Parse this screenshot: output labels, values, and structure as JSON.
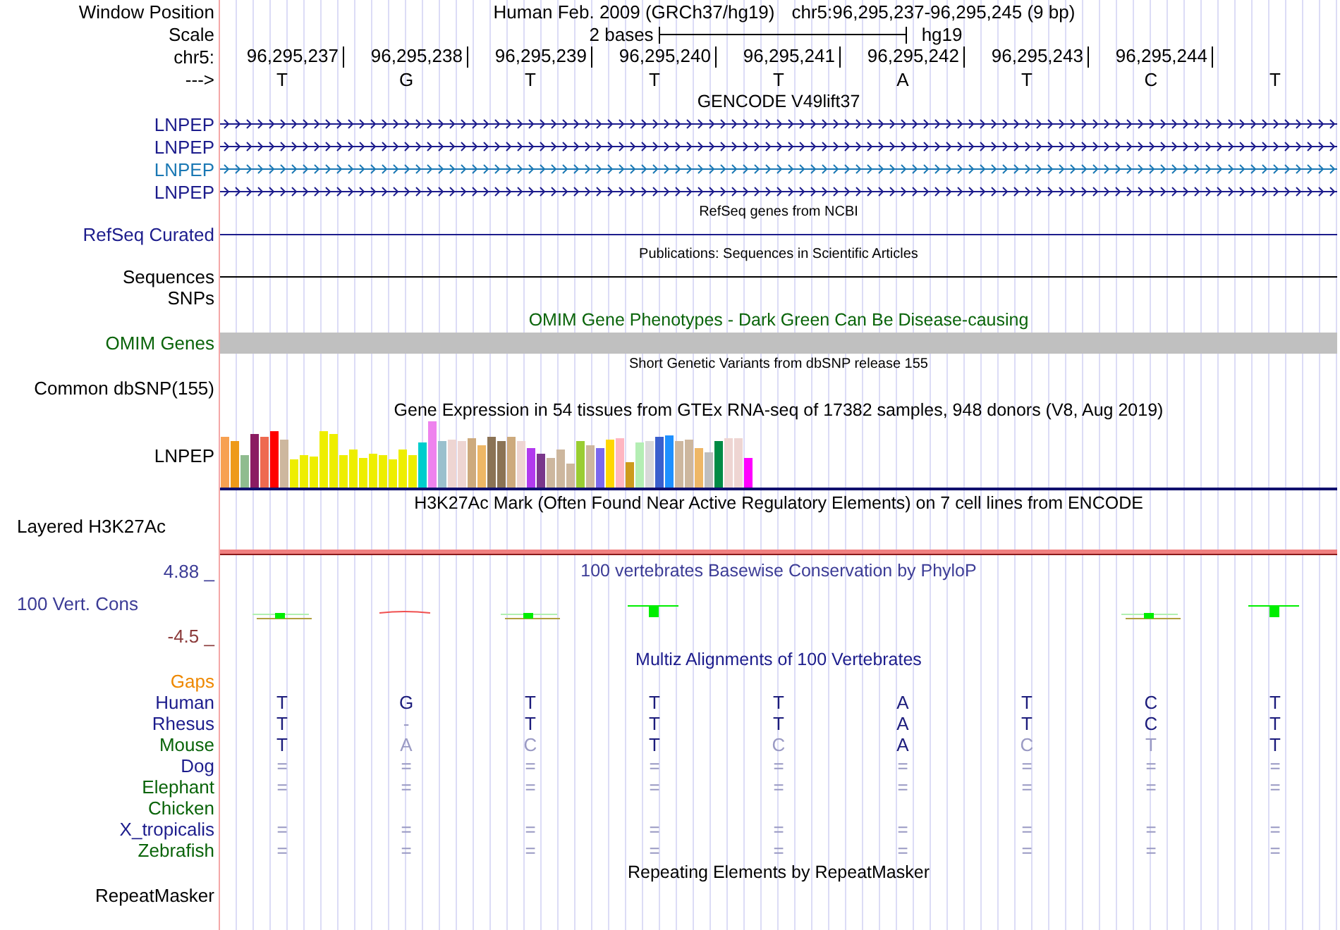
{
  "header": {
    "label": "Window Position",
    "title": "Human Feb. 2009 (GRCh37/hg19)",
    "position": "chr5:96,295,237-96,295,245 (9 bp)"
  },
  "scale": {
    "label": "Scale",
    "length": "2 bases",
    "assembly": "hg19"
  },
  "ruler": {
    "label": "chr5:",
    "ticks": [
      "96,295,237",
      "96,295,238",
      "96,295,239",
      "96,295,240",
      "96,295,241",
      "96,295,242",
      "96,295,243",
      "96,295,244"
    ],
    "strand": "--->",
    "bases": [
      "T",
      "G",
      "T",
      "T",
      "T",
      "A",
      "T",
      "C",
      "T"
    ]
  },
  "tracks": [
    {
      "kind": "gene",
      "title": "GENCODE V49lift37",
      "transcripts": [
        {
          "name": "LNPEP",
          "color": "#1c1c8c"
        },
        {
          "name": "LNPEP",
          "color": "#1c1c8c"
        },
        {
          "name": "LNPEP",
          "color": "#1a78b4"
        },
        {
          "name": "LNPEP",
          "color": "#1c1c8c"
        }
      ]
    },
    {
      "kind": "line",
      "title": "RefSeq genes from NCBI",
      "label": "RefSeq Curated",
      "color": "#1c1c8c"
    },
    {
      "kind": "line",
      "title": "Publications: Sequences in Scientific Articles",
      "label": "Sequences",
      "color": "#000000"
    },
    {
      "kind": "label",
      "label": "SNPs",
      "color": "#000000"
    },
    {
      "kind": "bar",
      "title": "OMIM Gene Phenotypes - Dark Green Can Be Disease-causing",
      "label": "OMIM Genes",
      "color": "#0a640a"
    },
    {
      "kind": "variants",
      "title": "Short Genetic Variants from dbSNP release 155",
      "label": "Common dbSNP(155)",
      "color": "#000000"
    },
    {
      "kind": "expression",
      "title": "Gene Expression in 54 tissues from GTEx RNA-seq of 17382 samples, 948 donors (V8, Aug 2019)",
      "label": "LNPEP",
      "color": "#000000"
    },
    {
      "kind": "signal",
      "title": "H3K27Ac Mark (Often Found Near Active Regulatory Elements) on 7 cell lines from ENCODE",
      "label": "Layered H3K27Ac",
      "color": "#000000"
    },
    {
      "kind": "conservation",
      "title": "100 vertebrates Basewise Conservation by PhyloP",
      "label": "100 Vert. Cons",
      "color": "#3c3c96",
      "max": "4.88 _",
      "min": "-4.5 _"
    },
    {
      "kind": "alignment",
      "title": "Multiz Alignments of 100 Vertebrates",
      "gaps_label": "Gaps",
      "species": [
        {
          "name": "Human",
          "color": "#1c1c8c",
          "bases": [
            {
              "text": "T",
              "faded": false
            },
            {
              "text": "G",
              "faded": false
            },
            {
              "text": "T",
              "faded": false
            },
            {
              "text": "T",
              "faded": false
            },
            {
              "text": "T",
              "faded": false
            },
            {
              "text": "A",
              "faded": false
            },
            {
              "text": "T",
              "faded": false
            },
            {
              "text": "C",
              "faded": false
            },
            {
              "text": "T",
              "faded": false
            }
          ]
        },
        {
          "name": "Rhesus",
          "color": "#1c1c8c",
          "bases": [
            {
              "text": "T",
              "faded": false
            },
            {
              "text": "-",
              "faded": true
            },
            {
              "text": "T",
              "faded": false
            },
            {
              "text": "T",
              "faded": false
            },
            {
              "text": "T",
              "faded": false
            },
            {
              "text": "A",
              "faded": false
            },
            {
              "text": "T",
              "faded": false
            },
            {
              "text": "C",
              "faded": false
            },
            {
              "text": "T",
              "faded": false
            }
          ]
        },
        {
          "name": "Mouse",
          "color": "#0a640a",
          "bases": [
            {
              "text": "T",
              "faded": false
            },
            {
              "text": "A",
              "faded": true
            },
            {
              "text": "C",
              "faded": true
            },
            {
              "text": "T",
              "faded": false
            },
            {
              "text": "C",
              "faded": true
            },
            {
              "text": "A",
              "faded": false
            },
            {
              "text": "C",
              "faded": true
            },
            {
              "text": "T",
              "faded": true
            },
            {
              "text": "T",
              "faded": false
            }
          ]
        },
        {
          "name": "Dog",
          "color": "#1c1c8c",
          "bases": [
            {
              "text": "=",
              "faded": true
            },
            {
              "text": "=",
              "faded": true
            },
            {
              "text": "=",
              "faded": true
            },
            {
              "text": "=",
              "faded": true
            },
            {
              "text": "=",
              "faded": true
            },
            {
              "text": "=",
              "faded": true
            },
            {
              "text": "=",
              "faded": true
            },
            {
              "text": "=",
              "faded": true
            },
            {
              "text": "=",
              "faded": true
            }
          ]
        },
        {
          "name": "Elephant",
          "color": "#0a640a",
          "bases": [
            {
              "text": "=",
              "faded": true
            },
            {
              "text": "=",
              "faded": true
            },
            {
              "text": "=",
              "faded": true
            },
            {
              "text": "=",
              "faded": true
            },
            {
              "text": "=",
              "faded": true
            },
            {
              "text": "=",
              "faded": true
            },
            {
              "text": "=",
              "faded": true
            },
            {
              "text": "=",
              "faded": true
            },
            {
              "text": "=",
              "faded": true
            }
          ]
        },
        {
          "name": "Chicken",
          "color": "#0a640a"
        },
        {
          "name": "X_tropicalis",
          "color": "#1c1c8c",
          "bases": [
            {
              "text": "=",
              "faded": true
            },
            {
              "text": "=",
              "faded": true
            },
            {
              "text": "=",
              "faded": true
            },
            {
              "text": "=",
              "faded": true
            },
            {
              "text": "=",
              "faded": true
            },
            {
              "text": "=",
              "faded": true
            },
            {
              "text": "=",
              "faded": true
            },
            {
              "text": "=",
              "faded": true
            },
            {
              "text": "=",
              "faded": true
            }
          ]
        },
        {
          "name": "Zebrafish",
          "color": "#0a640a",
          "bases": [
            {
              "text": "=",
              "faded": true
            },
            {
              "text": "=",
              "faded": true
            },
            {
              "text": "=",
              "faded": true
            },
            {
              "text": "=",
              "faded": true
            },
            {
              "text": "=",
              "faded": true
            },
            {
              "text": "=",
              "faded": true
            },
            {
              "text": "=",
              "faded": true
            },
            {
              "text": "=",
              "faded": true
            },
            {
              "text": "=",
              "faded": true
            }
          ]
        }
      ]
    },
    {
      "kind": "repeats",
      "title": "Repeating Elements by RepeatMasker",
      "label": "RepeatMasker",
      "color": "#000000"
    }
  ]
}
